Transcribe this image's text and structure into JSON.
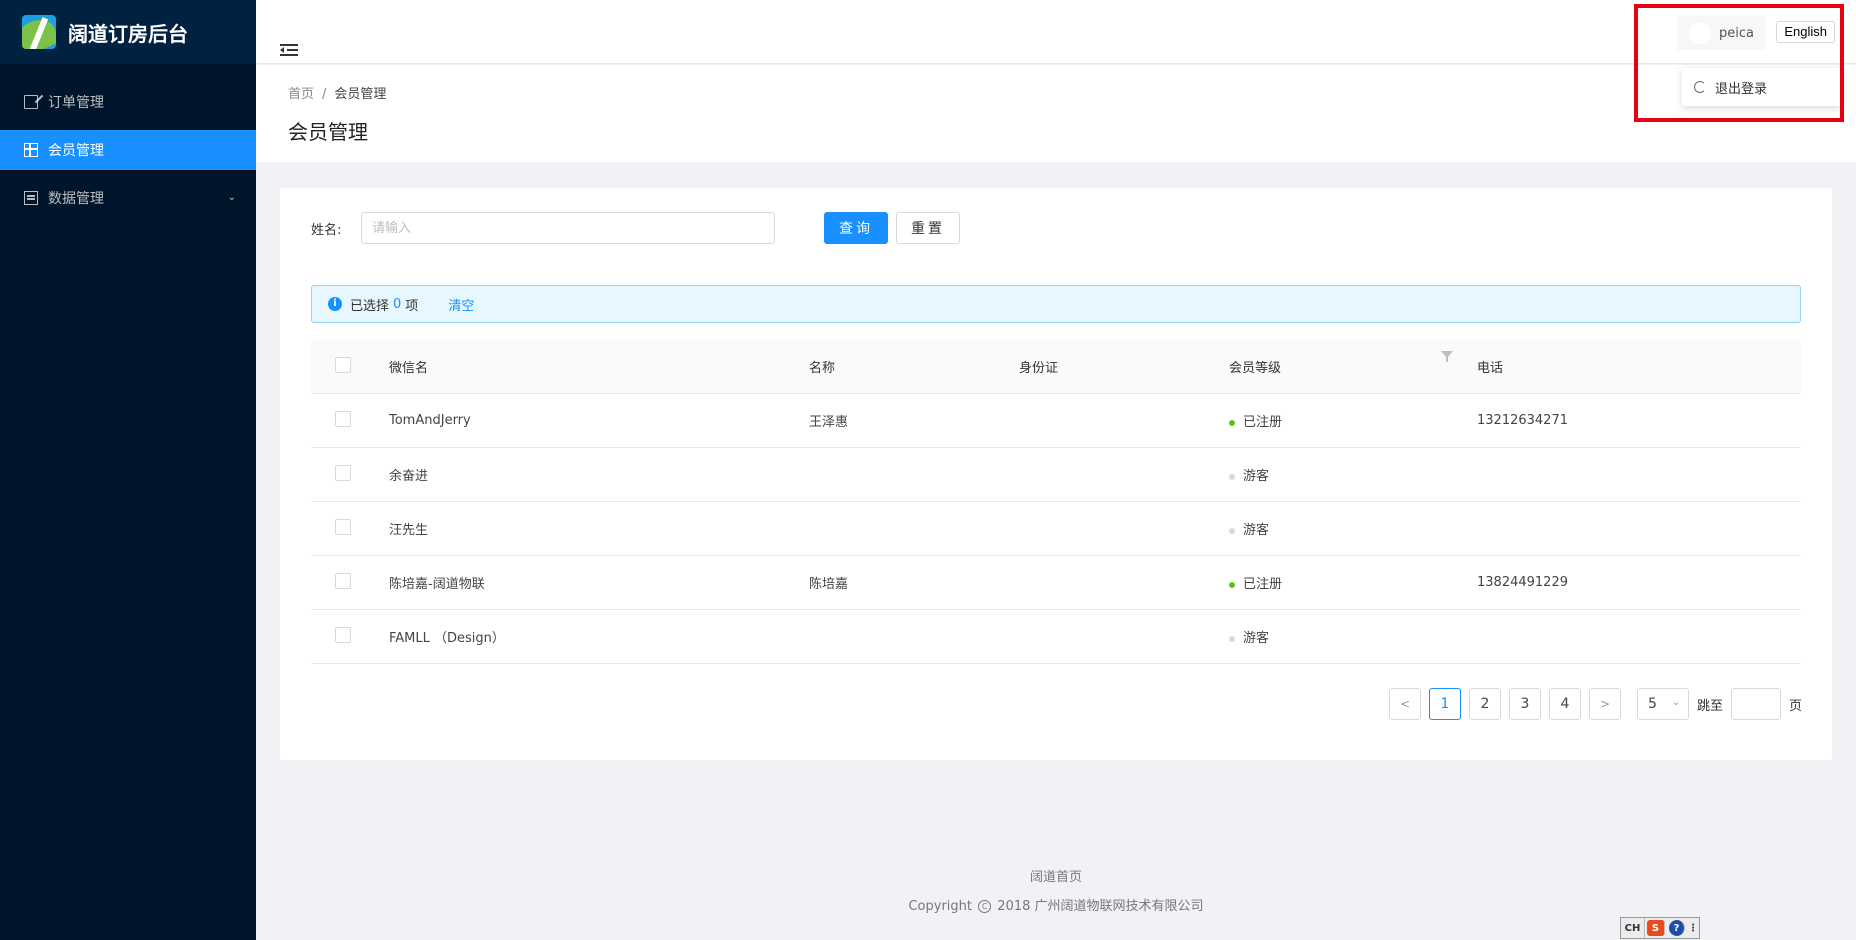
{
  "app": {
    "title": "阔道订房后台"
  },
  "sidebar": {
    "items": [
      {
        "label": "订单管理",
        "icon": "edit-icon"
      },
      {
        "label": "会员管理",
        "icon": "table-icon",
        "active": true
      },
      {
        "label": "数据管理",
        "icon": "list-icon",
        "has_submenu": true
      }
    ]
  },
  "header": {
    "user_name": "peica",
    "language_button": "English",
    "dropdown": {
      "logout_label": "退出登录"
    }
  },
  "breadcrumb": {
    "home": "首页",
    "separator": "/",
    "current": "会员管理"
  },
  "page": {
    "title": "会员管理"
  },
  "search": {
    "label": "姓名:",
    "placeholder": "请输入",
    "value": "",
    "query_button": "查询",
    "reset_button": "重置"
  },
  "selection_alert": {
    "prefix": "已选择",
    "count": "0",
    "suffix": "项",
    "clear_label": "清空"
  },
  "table": {
    "columns": [
      "微信名",
      "名称",
      "身份证",
      "会员等级",
      "电话"
    ],
    "rows": [
      {
        "wechat": "TomAndJerry",
        "name": "王泽惠",
        "id_card": "",
        "level": "已注册",
        "level_status": "registered",
        "phone": "13212634271"
      },
      {
        "wechat": "余奋进",
        "name": "",
        "id_card": "",
        "level": "游客",
        "level_status": "guest",
        "phone": ""
      },
      {
        "wechat": "汪先生",
        "name": "",
        "id_card": "",
        "level": "游客",
        "level_status": "guest",
        "phone": ""
      },
      {
        "wechat": "陈培嘉-阔道物联",
        "name": "陈培嘉",
        "id_card": "",
        "level": "已注册",
        "level_status": "registered",
        "phone": "13824491229"
      },
      {
        "wechat": "FAMLL （Design）",
        "name": "",
        "id_card": "",
        "level": "游客",
        "level_status": "guest",
        "phone": ""
      }
    ]
  },
  "pagination": {
    "pages": [
      "1",
      "2",
      "3",
      "4"
    ],
    "current_page": "1",
    "prev_symbol": "<",
    "next_symbol": ">",
    "page_size": "5",
    "jump_label": "跳至",
    "jump_value": "",
    "jump_suffix": "页"
  },
  "footer": {
    "link": "阔道首页",
    "copyright_prefix": "Copyright",
    "copyright_symbol": "C",
    "copyright_text": "2018 广州阔道物联网技术有限公司"
  },
  "ime_toolbar": {
    "mode": "CH",
    "brand": "S",
    "help": "?"
  },
  "colors": {
    "primary": "#1890ff",
    "sidebar_bg": "#001529",
    "registered_dot": "#52c41a",
    "guest_dot": "#d9d9d9",
    "highlight_border": "#e60012"
  }
}
